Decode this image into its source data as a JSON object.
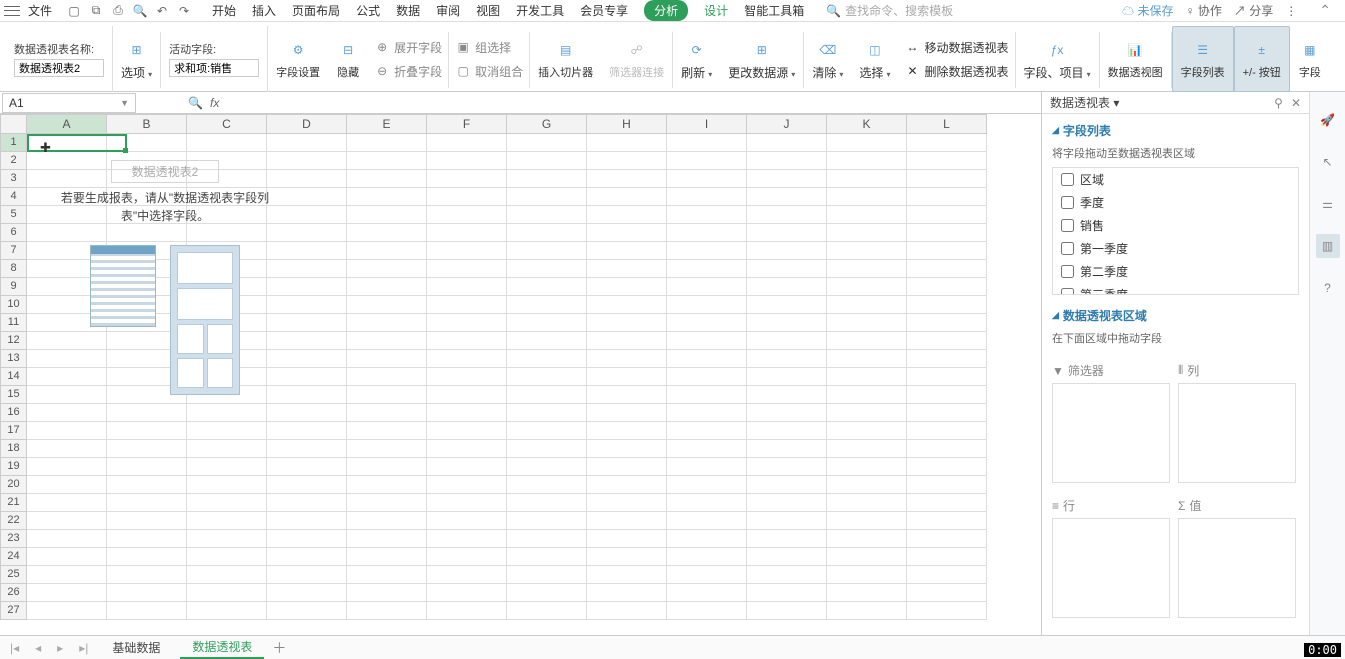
{
  "menubar": {
    "file": "文件",
    "tabs": [
      "开始",
      "插入",
      "页面布局",
      "公式",
      "数据",
      "审阅",
      "视图",
      "开发工具",
      "会员专享",
      "分析",
      "设计",
      "智能工具箱"
    ],
    "active_tab_index": 9,
    "teal_tab_index": 10,
    "search_placeholder": "查找命令、搜索模板",
    "unsaved": "未保存",
    "collab": "协作",
    "share": "分享"
  },
  "ribbon": {
    "name_label": "数据透视表名称:",
    "name_value": "数据透视表2",
    "options_btn": "选项",
    "active_field_label": "活动字段:",
    "active_field_value": "求和项:销售",
    "field_settings": "字段设置",
    "hide": "隐藏",
    "expand_field": "展开字段",
    "collapse_field": "折叠字段",
    "group_select": "组选择",
    "ungroup": "取消组合",
    "insert_slicer": "插入切片器",
    "filter_conn": "筛选器连接",
    "refresh": "刷新",
    "change_source": "更改数据源",
    "clear": "清除",
    "select": "选择",
    "move_pivot": "移动数据透视表",
    "delete_pivot": "删除数据透视表",
    "fields_items": "字段、项目",
    "pivot_chart": "数据透视图",
    "field_list": "字段列表",
    "pm_buttons": "+/- 按钮",
    "field_headers": "字段"
  },
  "cellbar": {
    "ref": "A1",
    "fx": "fx"
  },
  "grid": {
    "columns": [
      "A",
      "B",
      "C",
      "D",
      "E",
      "F",
      "G",
      "H",
      "I",
      "J",
      "K",
      "L"
    ],
    "rows": 27,
    "active_col": 0,
    "active_row": 0
  },
  "pivot_placeholder": {
    "title": "数据透视表2",
    "desc": "若要生成报表，请从\"数据透视表字段列表\"中选择字段。"
  },
  "taskpane": {
    "title": "数据透视表",
    "sec1_title": "字段列表",
    "sec1_sub": "将字段拖动至数据透视表区域",
    "fields": [
      "区域",
      "季度",
      "销售",
      "第一季度",
      "第二季度",
      "第三季度"
    ],
    "sec2_title": "数据透视表区域",
    "sec2_sub": "在下面区域中拖动字段",
    "zones": {
      "filter": "筛选器",
      "column": "列",
      "row": "行",
      "value": "值"
    }
  },
  "sheets": {
    "tabs": [
      "基础数据",
      "数据透视表"
    ],
    "active_index": 1
  },
  "timer": "0:00"
}
